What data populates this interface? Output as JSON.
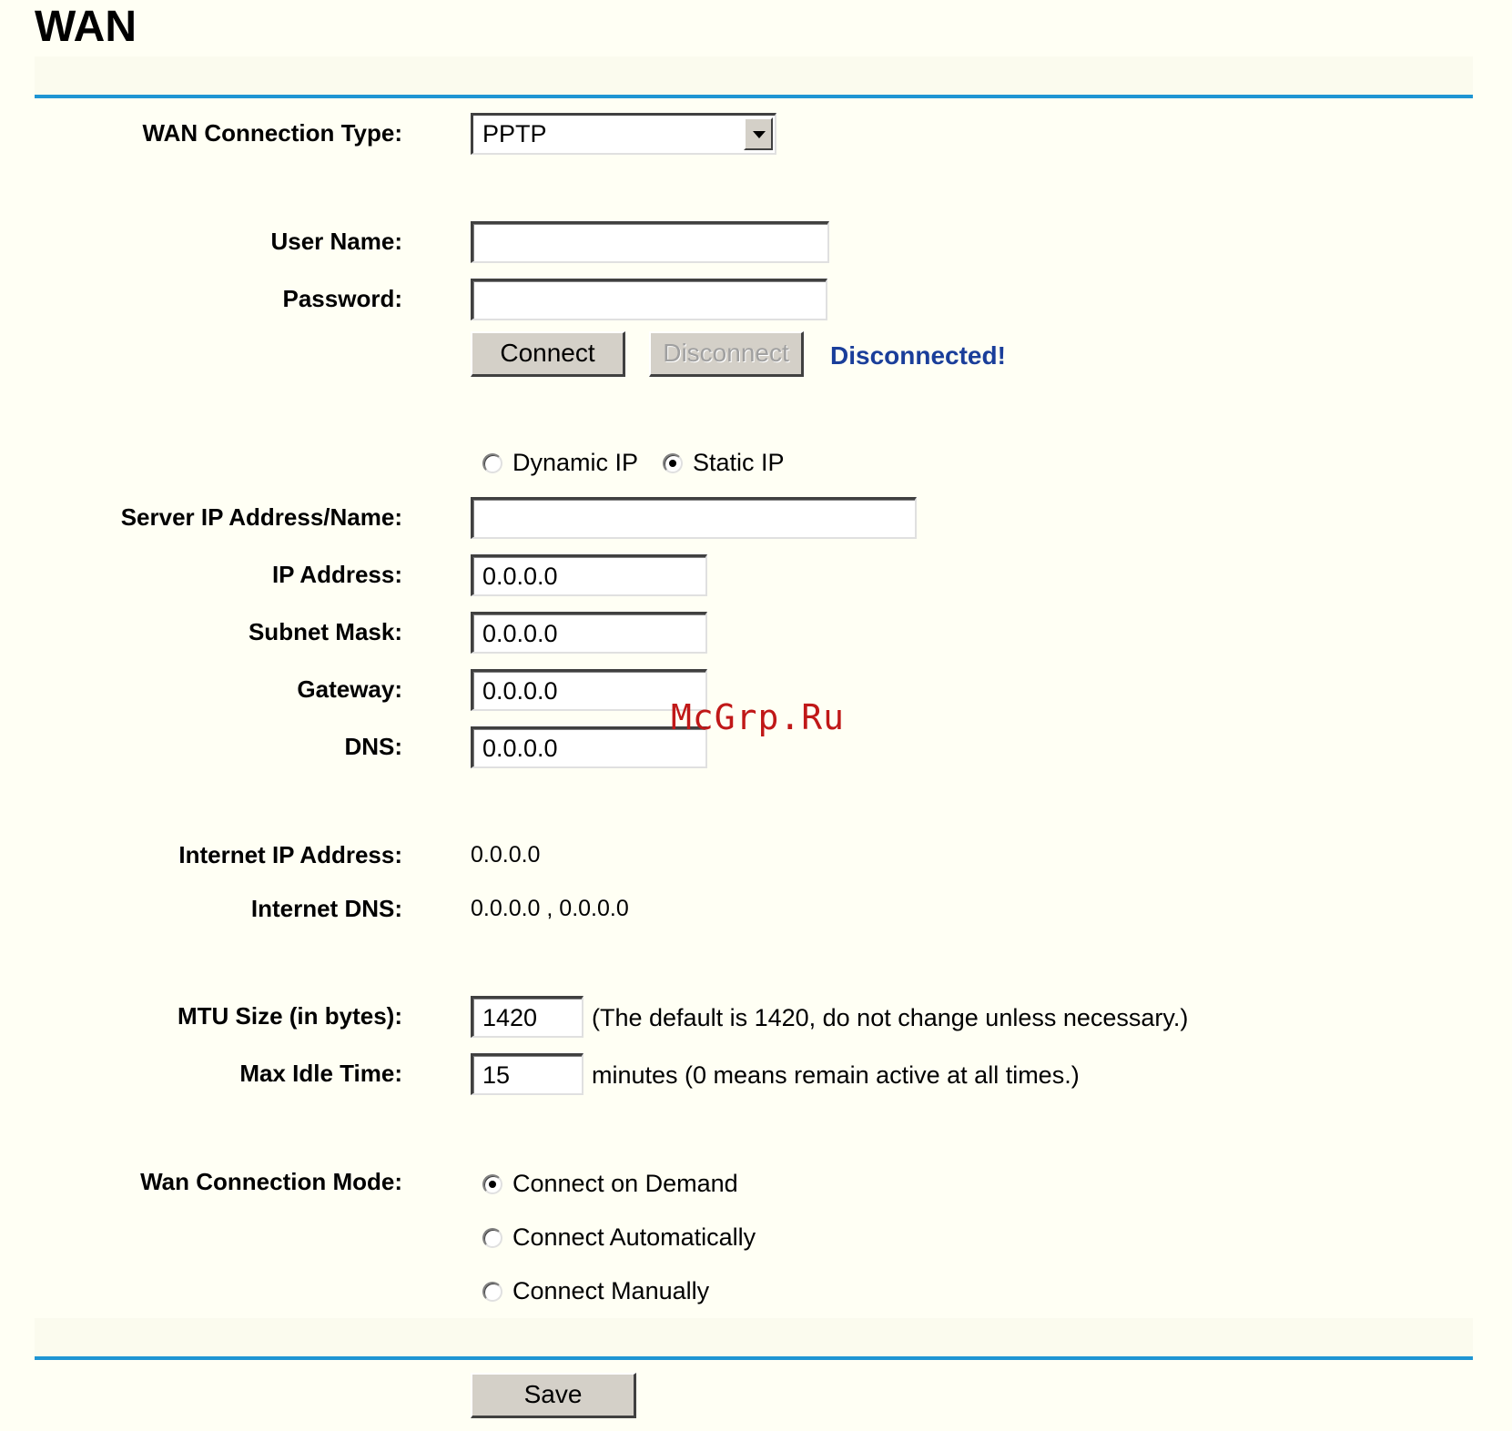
{
  "page": {
    "title": "WAN",
    "watermark": "McGrp.Ru"
  },
  "wan_type": {
    "label": "WAN Connection Type:",
    "selected": "PPTP"
  },
  "account": {
    "username_label": "User Name:",
    "username_value": "",
    "password_label": "Password:",
    "password_value": "",
    "connect_label": "Connect",
    "disconnect_label": "Disconnect",
    "status": "Disconnected!",
    "status_color": "#1a3e9a"
  },
  "ip_mode": {
    "dynamic_label": "Dynamic IP",
    "static_label": "Static IP",
    "selected": "Static IP"
  },
  "static": {
    "server_label": "Server IP Address/Name:",
    "server_value": "",
    "ip_label": "IP Address:",
    "ip_value": "0.0.0.0",
    "mask_label": "Subnet Mask:",
    "mask_value": "0.0.0.0",
    "gateway_label": "Gateway:",
    "gateway_value": "0.0.0.0",
    "dns_label": "DNS:",
    "dns_value": "0.0.0.0"
  },
  "internet": {
    "ip_label": "Internet IP Address:",
    "ip_value": "0.0.0.0",
    "dns_label": "Internet DNS:",
    "dns_value": "0.0.0.0 , 0.0.0.0"
  },
  "advanced": {
    "mtu_label": "MTU Size (in bytes):",
    "mtu_value": "1420",
    "mtu_hint": "(The default is 1420, do not change unless necessary.)",
    "idle_label": "Max Idle Time:",
    "idle_value": "15",
    "idle_hint": "minutes (0 means remain active at all times.)"
  },
  "mode": {
    "label": "Wan Connection Mode:",
    "options": [
      "Connect on Demand",
      "Connect Automatically",
      "Connect Manually"
    ],
    "selected": "Connect on Demand"
  },
  "footer": {
    "save_label": "Save"
  },
  "colors": {
    "background": "#fffff4",
    "divider": "#1f95d3"
  }
}
